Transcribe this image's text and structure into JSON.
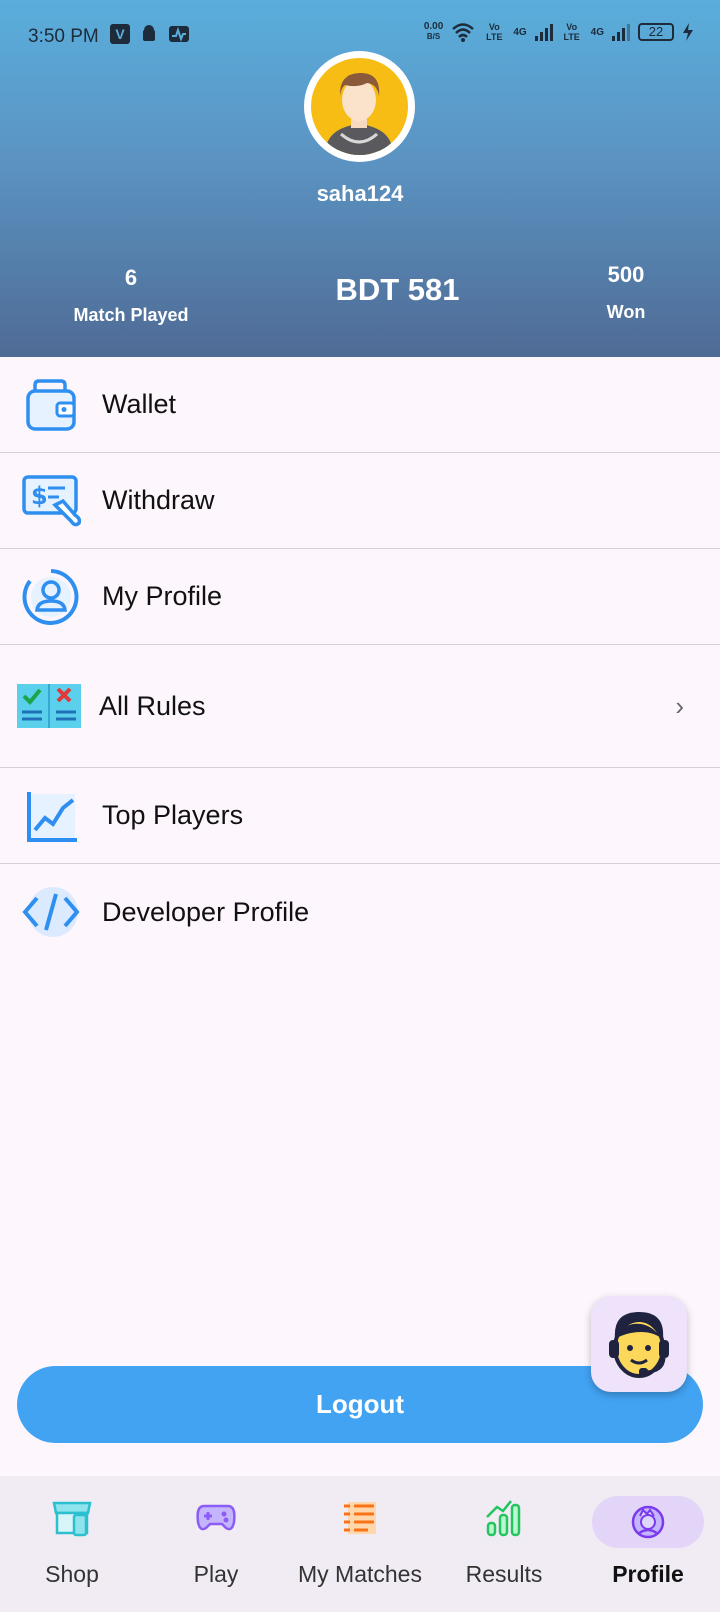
{
  "status_bar": {
    "time": "3:50 PM",
    "net_speed_top": "0.00",
    "net_speed_unit": "B/S",
    "carrier1": "Vo LTE",
    "carrier2": "4G",
    "battery": "22"
  },
  "profile": {
    "username": "saha124",
    "matches_played_value": "6",
    "matches_played_label": "Match Played",
    "balance": "BDT 581",
    "won_value": "500",
    "won_label": "Won"
  },
  "menu": [
    {
      "label": "Wallet",
      "icon": "wallet-icon"
    },
    {
      "label": "Withdraw",
      "icon": "withdraw-icon"
    },
    {
      "label": "My Profile",
      "icon": "user-circle-icon"
    },
    {
      "label": "All Rules",
      "icon": "rules-book-icon"
    },
    {
      "label": "Top Players",
      "icon": "chart-line-icon"
    },
    {
      "label": "Developer Profile",
      "icon": "code-icon"
    }
  ],
  "logout_label": "Logout",
  "bottom_nav": [
    {
      "label": "Shop",
      "icon": "shop-icon",
      "color": "#2bbfcf"
    },
    {
      "label": "Play",
      "icon": "gamepad-icon",
      "color": "#8b5cf6"
    },
    {
      "label": "My Matches",
      "icon": "list-icon",
      "color": "#f97316"
    },
    {
      "label": "Results",
      "icon": "results-chart-icon",
      "color": "#22c55e"
    },
    {
      "label": "Profile",
      "icon": "profile-icon",
      "color": "#7c3aed",
      "active": true
    }
  ],
  "colors": {
    "accent": "#42a3f3",
    "header_top": "#5aaedc",
    "header_bottom": "#4f6b95"
  }
}
